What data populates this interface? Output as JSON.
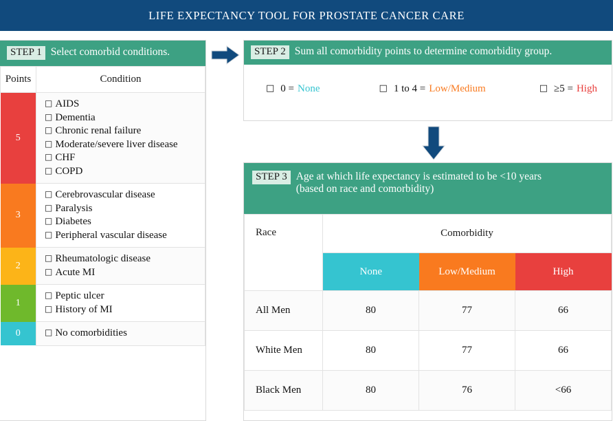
{
  "header": {
    "title": "LIFE EXPECTANCY TOOL FOR PROSTATE CANCER CARE",
    "background_color": "#114A7D"
  },
  "colors": {
    "teal_header": "#3DA183",
    "badge_bg": "#D9EDE4",
    "navy": "#114A7D",
    "points_5": "#E8403E",
    "points_3": "#F97A1F",
    "points_2": "#FCB418",
    "points_1": "#6FB92C",
    "points_0": "#35C4D0",
    "none": "#35C4D0",
    "low_medium": "#F97A1F",
    "high": "#E8403E"
  },
  "step1": {
    "badge": "STEP 1",
    "label": "Select comorbid conditions.",
    "columns": {
      "points": "Points",
      "condition": "Condition"
    },
    "rows": [
      {
        "points": "5",
        "color": "#E8403E",
        "conditions": [
          "AIDS",
          "Dementia",
          "Chronic renal failure",
          "Moderate/severe liver disease",
          "CHF",
          "COPD"
        ]
      },
      {
        "points": "3",
        "color": "#F97A1F",
        "conditions": [
          "Cerebrovascular disease",
          "Paralysis",
          "Diabetes",
          "Peripheral vascular disease"
        ]
      },
      {
        "points": "2",
        "color": "#FCB418",
        "conditions": [
          "Rheumatologic disease",
          "Acute MI"
        ]
      },
      {
        "points": "1",
        "color": "#6FB92C",
        "conditions": [
          "Peptic ulcer",
          "History of MI"
        ]
      },
      {
        "points": "0",
        "color": "#35C4D0",
        "conditions": [
          "No comorbidities"
        ]
      }
    ]
  },
  "step2": {
    "badge": "STEP 2",
    "label": "Sum all comorbidity points to determine comorbidity group.",
    "options": [
      {
        "range": "0 =",
        "group": "None",
        "color": "#35C4D0"
      },
      {
        "range": "1 to 4 =",
        "group": "Low/Medium",
        "color": "#F97A1F"
      },
      {
        "range": "≥5 =",
        "group": "High",
        "color": "#E8403E"
      }
    ]
  },
  "step3": {
    "badge": "STEP 3",
    "label_line1": "Age at which life expectancy is estimated to be <10 years",
    "label_line2": "(based on race and comorbidity)",
    "table": {
      "race_header": "Race",
      "comorbidity_header": "Comorbidity",
      "group_headers": [
        {
          "label": "None",
          "color": "#35C4D0"
        },
        {
          "label": "Low/Medium",
          "color": "#F97A1F"
        },
        {
          "label": "High",
          "color": "#E8403E"
        }
      ],
      "rows": [
        {
          "race": "All Men",
          "none": "80",
          "low_medium": "77",
          "high": "66"
        },
        {
          "race": "White Men",
          "none": "80",
          "low_medium": "77",
          "high": "66"
        },
        {
          "race": "Black Men",
          "none": "80",
          "low_medium": "76",
          "high": "<66"
        }
      ]
    }
  },
  "icons": {
    "checkbox": "□",
    "arrow_right": "arrow-right-icon",
    "arrow_down": "arrow-down-icon"
  }
}
